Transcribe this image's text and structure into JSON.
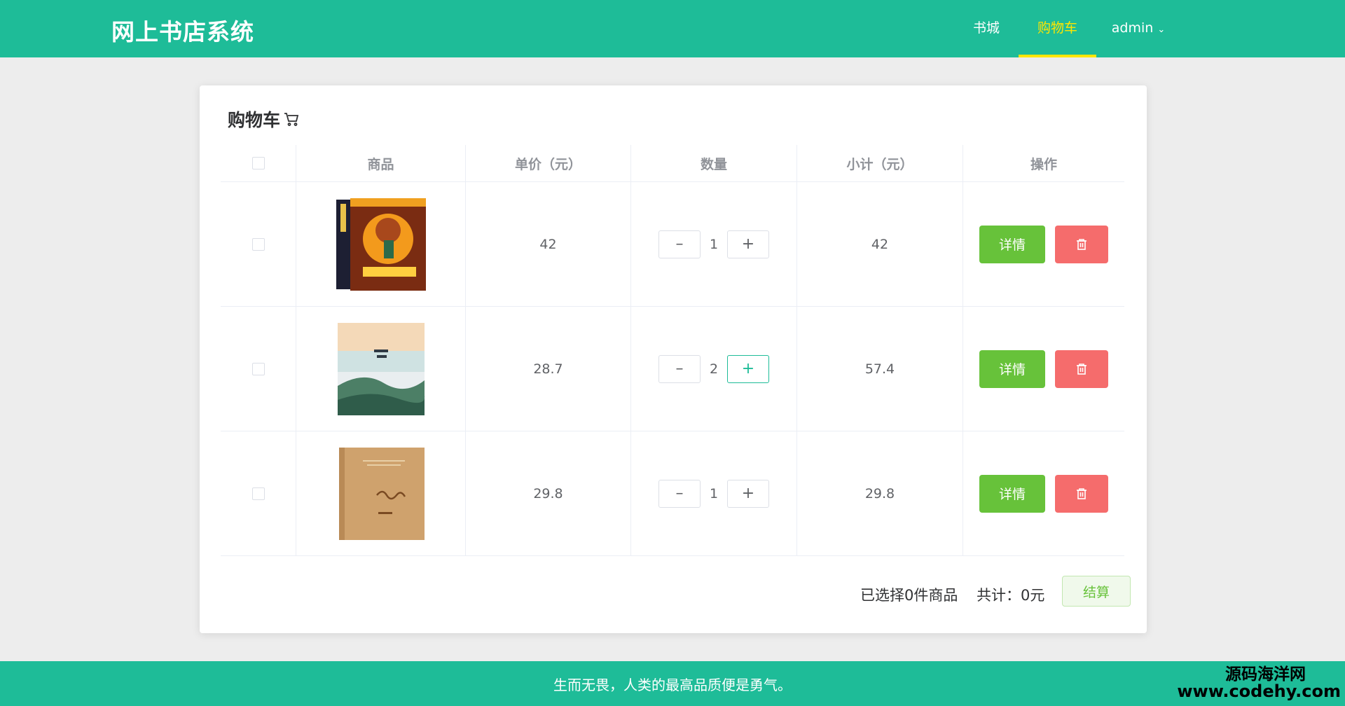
{
  "header": {
    "logo": "网上书店系统",
    "nav": {
      "books": "书城",
      "cart": "购物车",
      "user": "admin"
    }
  },
  "cart": {
    "title": "购物车",
    "columns": {
      "product": "商品",
      "price": "单价（元）",
      "quantity": "数量",
      "subtotal": "小计（元）",
      "actions": "操作"
    },
    "items": [
      {
        "price": "42",
        "quantity": "1",
        "subtotal": "42",
        "detail_label": "详情"
      },
      {
        "price": "28.7",
        "quantity": "2",
        "subtotal": "57.4",
        "detail_label": "详情"
      },
      {
        "price": "29.8",
        "quantity": "1",
        "subtotal": "29.8",
        "detail_label": "详情"
      }
    ],
    "summary": {
      "selected": "已选择0件商品",
      "total": "共计：0元"
    },
    "checkout_label": "结算"
  },
  "footer": {
    "motto": "生而无畏，人类的最高品质便是勇气。"
  },
  "watermark": {
    "line1": "源码海洋网",
    "line2": "www.codehy.com"
  },
  "colors": {
    "primary": "#1ebc98",
    "active_nav": "#ffe600",
    "detail_button": "#67c23a",
    "delete_button": "#f56c6c"
  },
  "icons": {
    "cart_title": "shopping-cart-icon",
    "user_menu": "chevron-down-icon",
    "minus": "minus-icon",
    "plus": "plus-icon",
    "delete": "trash-icon"
  }
}
